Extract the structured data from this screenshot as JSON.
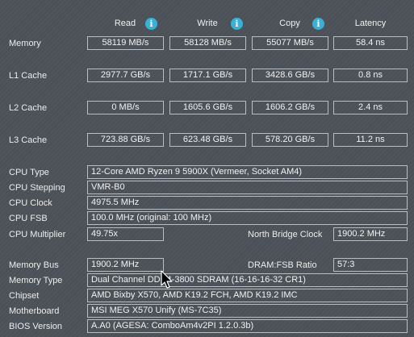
{
  "headers": {
    "read": "Read",
    "write": "Write",
    "copy": "Copy",
    "latency": "Latency"
  },
  "info_icon": "i",
  "benchmarks": [
    {
      "label": "Memory",
      "read": "58119 MB/s",
      "write": "58128 MB/s",
      "copy": "55077 MB/s",
      "latency": "58.4 ns"
    },
    {
      "label": "L1 Cache",
      "read": "2977.7 GB/s",
      "write": "1717.1 GB/s",
      "copy": "3428.6 GB/s",
      "latency": "0.8 ns"
    },
    {
      "label": "L2 Cache",
      "read": "0 MB/s",
      "write": "1605.6 GB/s",
      "copy": "1606.2 GB/s",
      "latency": "2.4 ns"
    },
    {
      "label": "L3 Cache",
      "read": "723.88 GB/s",
      "write": "623.48 GB/s",
      "copy": "578.20 GB/s",
      "latency": "11.2 ns"
    }
  ],
  "cpu": {
    "type_label": "CPU Type",
    "type": "12-Core AMD Ryzen 9 5900X  (Vermeer, Socket AM4)",
    "stepping_label": "CPU Stepping",
    "stepping": "VMR-B0",
    "clock_label": "CPU Clock",
    "clock": "4975.5 MHz",
    "fsb_label": "CPU FSB",
    "fsb": "100.0 MHz  (original: 100 MHz)",
    "multiplier_label": "CPU Multiplier",
    "multiplier": "49.75x",
    "nb_clock_label": "North Bridge Clock",
    "nb_clock": "1900.2 MHz"
  },
  "memory": {
    "bus_label": "Memory Bus",
    "bus": "1900.2 MHz",
    "ratio_label": "DRAM:FSB Ratio",
    "ratio": "57:3",
    "type_label": "Memory Type",
    "type": "Dual Channel DDR4-3800 SDRAM  (16-16-16-32 CR1)",
    "chipset_label": "Chipset",
    "chipset": "AMD Bixby X570, AMD K19.2 FCH, AMD K19.2 IMC",
    "motherboard_label": "Motherboard",
    "motherboard": "MSI MEG X570 Unify (MS-7C35)",
    "bios_label": "BIOS Version",
    "bios": "A.A0  (AGESA: ComboAm4v2PI 1.2.0.3b)"
  },
  "colors": {
    "background": "#4c5259",
    "box_border": "#b9bec3",
    "info_icon": "#3ab0d6"
  }
}
